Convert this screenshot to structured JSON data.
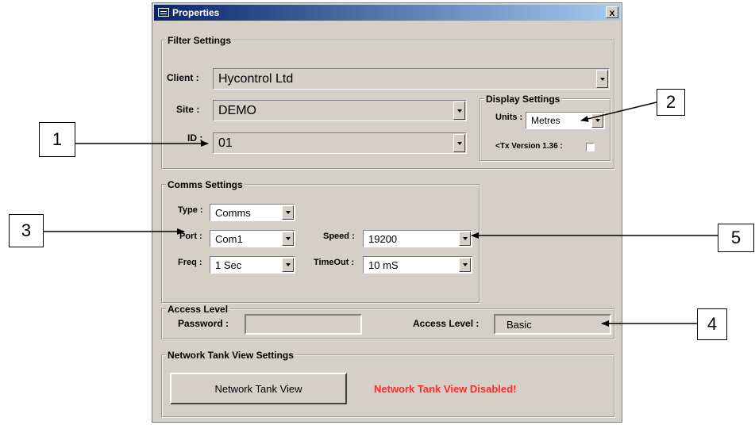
{
  "window": {
    "title": "Properties",
    "close_label": "x"
  },
  "filter_settings": {
    "legend": "Filter Settings",
    "client_label": "Client :",
    "client_value": "Hycontrol Ltd",
    "site_label": "Site :",
    "site_value": "DEMO",
    "id_label": "ID :",
    "id_value": "01"
  },
  "display_settings": {
    "legend": "Display Settings",
    "units_label": "Units :",
    "units_value": "Metres",
    "tx_version_label": "<Tx Version 1.36 :",
    "tx_version_checked": false
  },
  "comms_settings": {
    "legend": "Comms Settings",
    "type_label": "Type :",
    "type_value": "Comms",
    "port_label": "Port :",
    "port_value": "Com1",
    "freq_label": "Freq :",
    "freq_value": "1 Sec",
    "speed_label": "Speed :",
    "speed_value": "19200",
    "timeout_label": "TimeOut :",
    "timeout_value": "10 mS"
  },
  "access_level": {
    "legend": "Access Level",
    "password_label": "Password :",
    "password_value": "",
    "access_level_label": "Access Level :",
    "access_level_value": "Basic"
  },
  "network": {
    "legend": "Network Tank View Settings",
    "button_label": "Network Tank View",
    "status_text": "Network Tank View Disabled!",
    "status_color": "#ff2a2a"
  },
  "callouts": [
    "1",
    "2",
    "3",
    "4",
    "5"
  ]
}
